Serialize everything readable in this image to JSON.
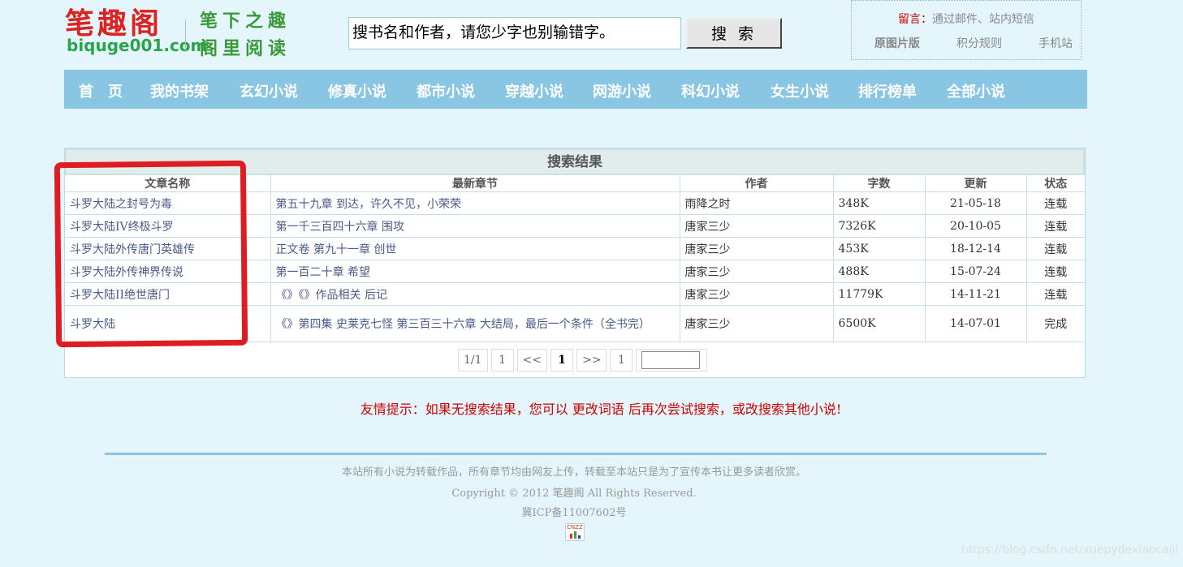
{
  "logo": {
    "name": "笔趣阁",
    "domain": "biquge001.com",
    "slogan_line1": "笔下之趣",
    "slogan_line2": "阁里阅读"
  },
  "search": {
    "value": "搜书名和作者，请您少字也别输错字。",
    "button_label": "搜 索"
  },
  "topbox": {
    "message_label": "留言：",
    "message_text": "通过邮件、站内短信",
    "links": [
      "原图片版",
      "积分规则",
      "手机站"
    ]
  },
  "nav": {
    "items": [
      "首　页",
      "我的书架",
      "玄幻小说",
      "修真小说",
      "都市小说",
      "穿越小说",
      "网游小说",
      "科幻小说",
      "女生小说",
      "排行榜单",
      "全部小说"
    ]
  },
  "results": {
    "title": "搜索结果",
    "headers": [
      "文章名称",
      "最新章节",
      "作者",
      "字数",
      "更新",
      "状态"
    ],
    "rows": [
      {
        "name": "斗罗大陆之封号为毒",
        "chapter": "第五十九章 到达，许久不见，小荣荣",
        "author": "雨降之时",
        "words": "348K",
        "updated": "21-05-18",
        "status": "连载"
      },
      {
        "name": "斗罗大陆IV终极斗罗",
        "chapter": "第一千三百四十六章 围攻",
        "author": "唐家三少",
        "words": "7326K",
        "updated": "20-10-05",
        "status": "连载"
      },
      {
        "name": "斗罗大陆外传唐门英雄传",
        "chapter": "正文卷 第九十一章 创世",
        "author": "唐家三少",
        "words": "453K",
        "updated": "18-12-14",
        "status": "连载"
      },
      {
        "name": "斗罗大陆外传神界传说",
        "chapter": "第一百二十章 希望",
        "author": "唐家三少",
        "words": "488K",
        "updated": "15-07-24",
        "status": "连载"
      },
      {
        "name": "斗罗大陆II绝世唐门",
        "chapter": "《》《》作品相关 后记",
        "author": "唐家三少",
        "words": "11779K",
        "updated": "14-11-21",
        "status": "连载"
      },
      {
        "name": "斗罗大陆",
        "chapter": "《》第四集 史莱克七怪 第三百三十六章 大结局，最后一个条件（全书完）",
        "author": "唐家三少",
        "words": "6500K",
        "updated": "14-07-01",
        "status": "完成"
      }
    ]
  },
  "pager": {
    "info": "1/1",
    "first": "1",
    "prev": "<<",
    "current": "1",
    "next": ">>",
    "last": "1"
  },
  "tip": "友情提示：如果无搜索结果，您可以 更改词语 后再次尝试搜索，或改搜索其他小说!",
  "footer": {
    "line1": "本站所有小说为转载作品，所有章节均由网友上传，转载至本站只是为了宣传本书让更多读者欣赏。",
    "line2": "Copyright © 2012 笔趣阁 All Rights Reserved.",
    "line3": "冀ICP备11007602号",
    "stat_badge": "CNZZ"
  },
  "watermark": "https://blog.csdn.net/xuepydexiaocaiji",
  "colors": {
    "background": "#e4f6fb",
    "nav": "#88c6e3",
    "annotation": "#e11b22",
    "tip": "#cc0000"
  }
}
